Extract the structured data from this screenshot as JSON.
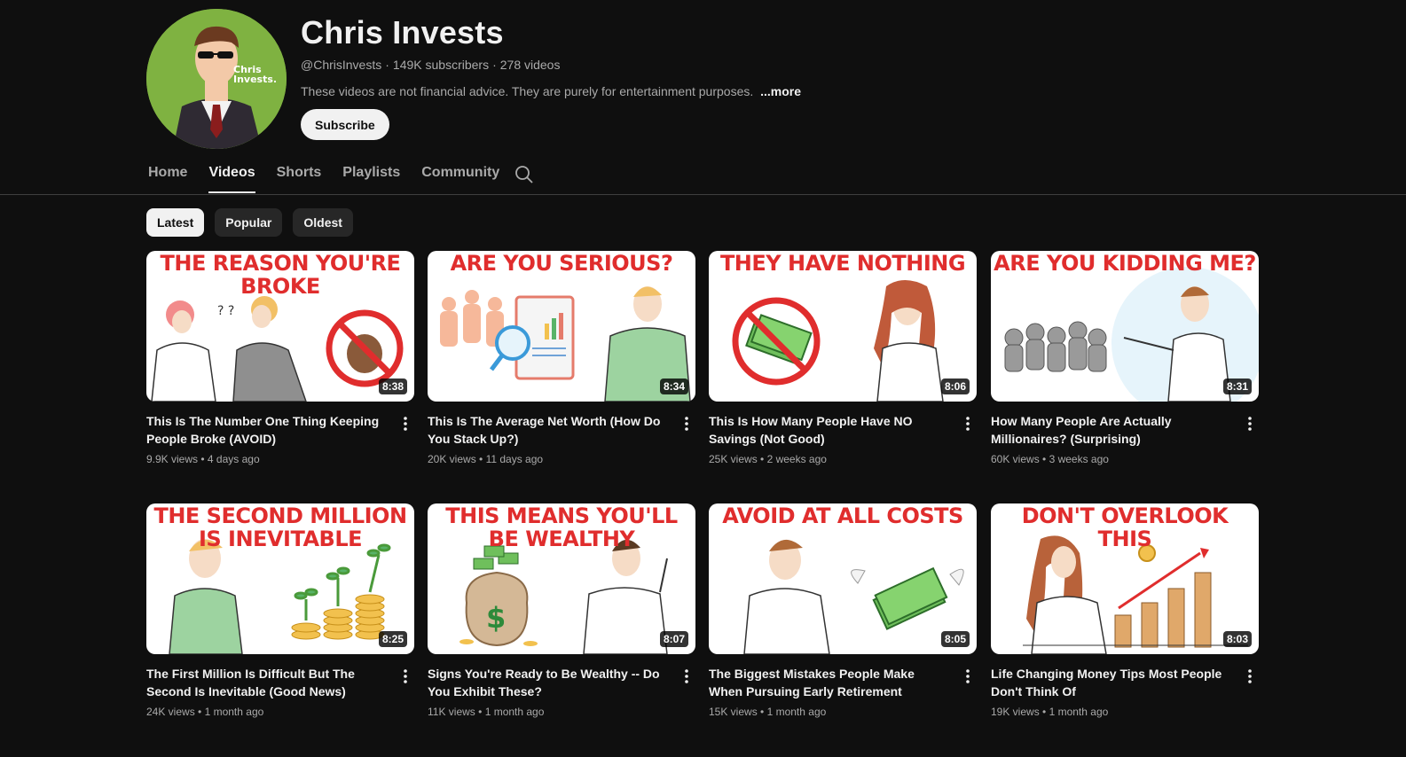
{
  "channel": {
    "name": "Chris Invests",
    "avatar_text": "Chris Invests.",
    "handle": "@ChrisInvests",
    "subscribers": "149K subscribers",
    "video_count": "278 videos",
    "description": "These videos are not financial advice. They are purely for entertainment purposes.",
    "more_label": "...more",
    "subscribe_label": "Subscribe"
  },
  "tabs": [
    {
      "label": "Home"
    },
    {
      "label": "Videos"
    },
    {
      "label": "Shorts"
    },
    {
      "label": "Playlists"
    },
    {
      "label": "Community"
    }
  ],
  "chips": [
    {
      "label": "Latest"
    },
    {
      "label": "Popular"
    },
    {
      "label": "Oldest"
    }
  ],
  "videos": [
    {
      "thumb_text": "THE REASON YOU'RE BROKE",
      "duration": "8:38",
      "title": "This Is The Number One Thing Keeping People Broke (AVOID)",
      "views": "9.9K views",
      "age": "4 days ago"
    },
    {
      "thumb_text": "ARE YOU SERIOUS?",
      "duration": "8:34",
      "title": "This Is The Average Net Worth (How Do You Stack Up?)",
      "views": "20K views",
      "age": "11 days ago"
    },
    {
      "thumb_text": "THEY HAVE NOTHING",
      "duration": "8:06",
      "title": "This Is How Many People Have NO Savings (Not Good)",
      "views": "25K views",
      "age": "2 weeks ago"
    },
    {
      "thumb_text": "ARE YOU KIDDING ME?",
      "duration": "8:31",
      "title": "How Many People Are Actually Millionaires? (Surprising)",
      "views": "60K views",
      "age": "3 weeks ago"
    },
    {
      "thumb_text": "THE SECOND MILLION IS INEVITABLE",
      "duration": "8:25",
      "title": "The First Million Is Difficult But The Second Is Inevitable (Good News)",
      "views": "24K views",
      "age": "1 month ago"
    },
    {
      "thumb_text": "THIS MEANS YOU'LL BE WEALTHY",
      "duration": "8:07",
      "title": "Signs You're Ready to Be Wealthy -- Do You Exhibit These?",
      "views": "11K views",
      "age": "1 month ago"
    },
    {
      "thumb_text": "AVOID AT ALL COSTS",
      "duration": "8:05",
      "title": "The Biggest Mistakes People Make When Pursuing Early Retirement",
      "views": "15K views",
      "age": "1 month ago"
    },
    {
      "thumb_text": "DON'T OVERLOOK THIS",
      "duration": "8:03",
      "title": "Life Changing Money Tips Most People Don't Think Of",
      "views": "19K views",
      "age": "1 month ago"
    }
  ],
  "icons": {
    "search": "search-icon",
    "more": "more-vert-icon"
  },
  "colors": {
    "background": "#0f0f0f",
    "thumb_title": "#e02d2d",
    "secondary_text": "#aaaaaa"
  }
}
